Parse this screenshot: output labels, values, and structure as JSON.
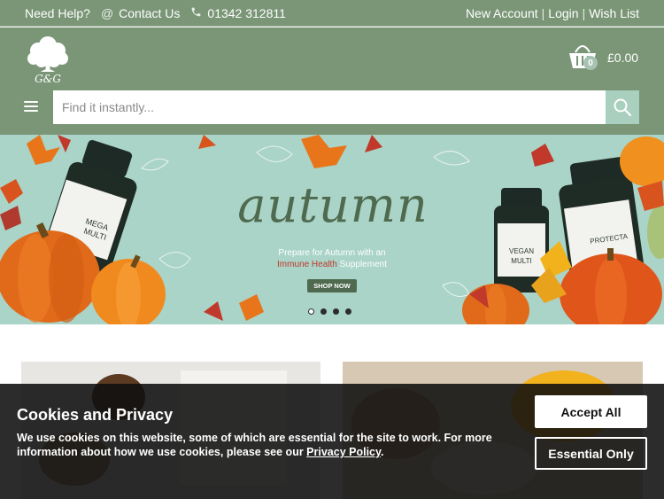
{
  "topbar": {
    "need_help": "Need Help?",
    "contact_icon": "at-icon",
    "contact_us": "Contact Us",
    "phone_icon": "phone-icon",
    "phone": "01342 312811",
    "new_account": "New Account",
    "separator": "|",
    "login": "Login",
    "wish_list": "Wish List"
  },
  "header": {
    "logo_icon": "tree-logo-icon",
    "logo_text": "G&G",
    "basket_icon": "basket-icon",
    "basket_count": "0",
    "cart_total": "£0.00",
    "menu_icon": "hamburger-icon"
  },
  "search": {
    "placeholder": "Find it instantly...",
    "value": "",
    "button_icon": "search-icon"
  },
  "hero": {
    "title": "autumn",
    "subtitle_line1": "Prepare for Autumn with an",
    "subtitle_highlight": "Immune Health",
    "subtitle_end": "Supplement",
    "cta": "SHOP NOW",
    "products": [
      "MEGA MULTI",
      "VEGAN MULTI",
      "PROTECTA"
    ],
    "slides_total": 4,
    "active_slide": 1
  },
  "cookie": {
    "title": "Cookies and Privacy",
    "text": "We use cookies on this website, some of which are essential for the site to work. For more information about how we use cookies, please see our ",
    "link": "Privacy Policy",
    "text_end": ".",
    "accept_all": "Accept All",
    "essential_only": "Essential Only"
  },
  "colors": {
    "header_green": "#7a9677",
    "hero_bg": "#a9d4c7",
    "search_button": "#a9cfbf",
    "title_green": "#4f6a4f",
    "highlight_red": "#c0392b"
  }
}
